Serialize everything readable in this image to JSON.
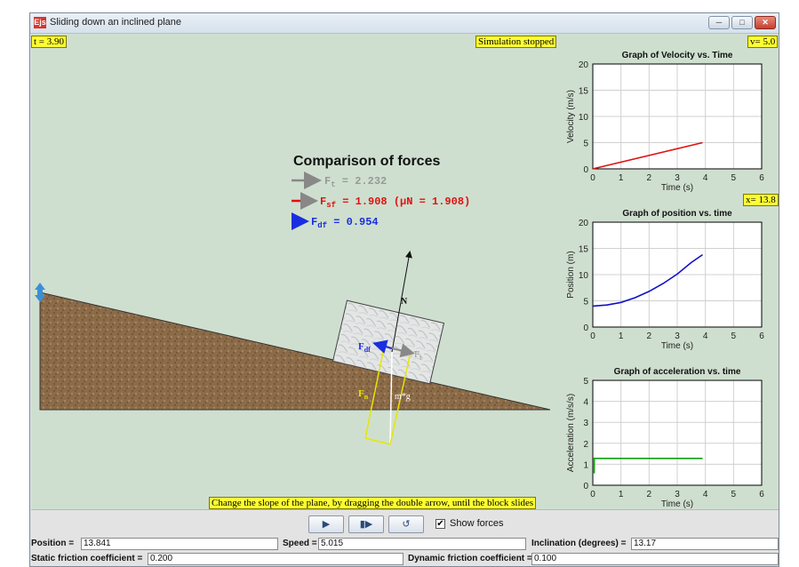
{
  "window": {
    "title": "Sliding down an inclined plane",
    "icon_text": "Ejs"
  },
  "overlays": {
    "time": "t = 3.90",
    "status": "Simulation stopped",
    "velocity_readout": "v= 5.0",
    "position_readout": "x= 13.8",
    "hint": "Change the slope of the plane, by dragging the double arrow, until the block slides"
  },
  "forces": {
    "heading": "Comparison of forces",
    "ft_value": " = 2.232",
    "fsf_value": " = 1.908 (μN = 1.908)",
    "fdf_value": " = 0.954"
  },
  "diagram": {
    "normal_label": "N",
    "fdf_label": "F",
    "ft_label": "F",
    "fn_label": "F",
    "weight_label": "m*g"
  },
  "charts": {
    "velocity": {
      "title": "Graph of Velocity vs. Time",
      "ylabel": "Velocity (m/s)",
      "xlabel": "Time (s)"
    },
    "position": {
      "title": "Graph of position vs. time",
      "ylabel": "Position (m)",
      "xlabel": "Time (s)"
    },
    "acceleration": {
      "title": "Graph of acceleration vs. time",
      "ylabel": "Acceleration (m/s/s)",
      "xlabel": "Time (s)"
    }
  },
  "chart_data": [
    {
      "type": "line",
      "title": "Graph of Velocity vs. Time",
      "xlabel": "Time (s)",
      "ylabel": "Velocity (m/s)",
      "xlim": [
        0,
        6
      ],
      "ylim": [
        0,
        20
      ],
      "xticks": [
        0,
        1,
        2,
        3,
        4,
        5,
        6
      ],
      "yticks": [
        0,
        5,
        10,
        15,
        20
      ],
      "grid": true,
      "color": "#e01010",
      "x": [
        0,
        3.9
      ],
      "y": [
        0,
        5.0
      ]
    },
    {
      "type": "line",
      "title": "Graph of position vs. time",
      "xlabel": "Time (s)",
      "ylabel": "Position (m)",
      "xlim": [
        0,
        6
      ],
      "ylim": [
        0,
        20
      ],
      "xticks": [
        0,
        1,
        2,
        3,
        4,
        5,
        6
      ],
      "yticks": [
        0,
        5,
        10,
        15,
        20
      ],
      "grid": true,
      "color": "#1010c8",
      "x": [
        0,
        0.5,
        1.0,
        1.5,
        2.0,
        2.5,
        3.0,
        3.5,
        3.9
      ],
      "y": [
        4.0,
        4.2,
        4.7,
        5.6,
        6.8,
        8.3,
        10.1,
        12.3,
        13.8
      ]
    },
    {
      "type": "line",
      "title": "Graph of acceleration vs. time",
      "xlabel": "Time (s)",
      "ylabel": "Acceleration (m/s/s)",
      "xlim": [
        0,
        6
      ],
      "ylim": [
        0,
        5
      ],
      "xticks": [
        0,
        1,
        2,
        3,
        4,
        5,
        6
      ],
      "yticks": [
        0,
        1,
        2,
        3,
        4,
        5
      ],
      "grid": true,
      "color": "#10a010",
      "x": [
        0,
        0.05,
        0.05,
        3.9
      ],
      "y": [
        0.6,
        0.6,
        1.28,
        1.28
      ]
    }
  ],
  "controls": {
    "play_icon": "▶",
    "step_icon": "▮▶",
    "reset_icon": "↺",
    "show_forces_label": "Show forces",
    "show_forces_check": "✔"
  },
  "fields": {
    "position_label": "Position =",
    "position_value": "13.841",
    "speed_label": "Speed =",
    "speed_value": "5.015",
    "inclination_label": "Inclination (degrees) =",
    "inclination_value": "13.17",
    "static_label": "Static friction coefficient =",
    "static_value": "0.200",
    "dynamic_label": "Dynamic friction coefficient =",
    "dynamic_value": "0.100"
  }
}
